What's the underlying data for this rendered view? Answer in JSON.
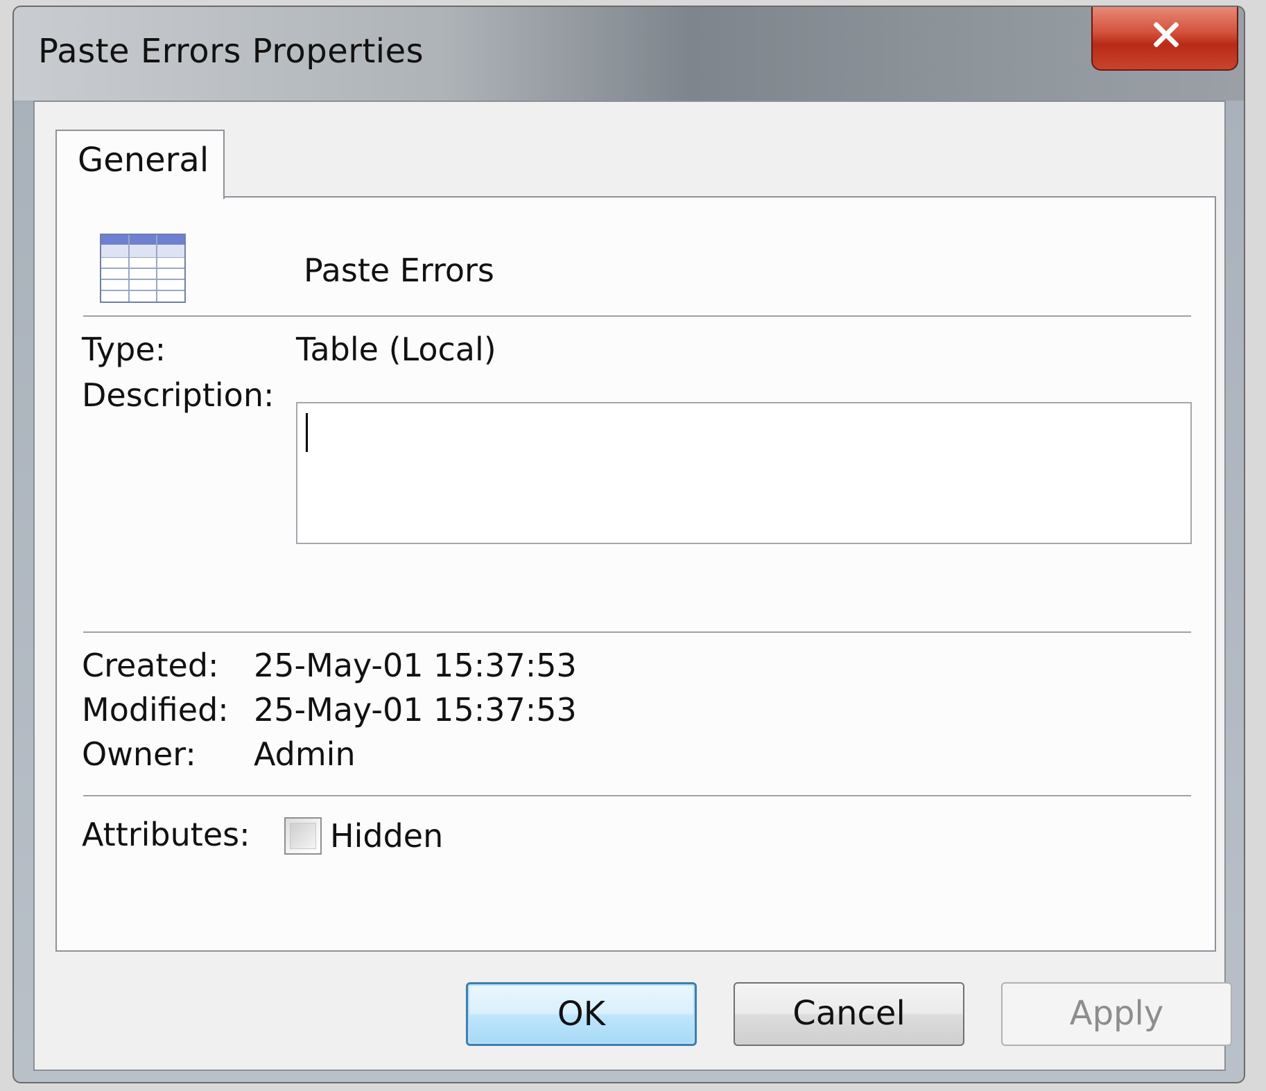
{
  "window": {
    "title": "Paste Errors Properties",
    "close_glyph": "X"
  },
  "tabs": [
    {
      "label": "General",
      "active": true
    }
  ],
  "general": {
    "icon": "table-icon",
    "object_name": "Paste Errors",
    "type_label": "Type:",
    "type_value": "Table (Local)",
    "description_label": "Description:",
    "description_value": "",
    "created_label": "Created:",
    "created_value": "25-May-01 15:37:53",
    "modified_label": "Modified:",
    "modified_value": "25-May-01 15:37:53",
    "owner_label": "Owner:",
    "owner_value": "Admin",
    "attributes_label": "Attributes:",
    "hidden_label": "Hidden",
    "hidden_checked": false
  },
  "buttons": {
    "ok": "OK",
    "cancel": "Cancel",
    "apply": "Apply"
  },
  "colors": {
    "close_button": "#c8432d",
    "ok_border": "#3c7fb1",
    "icon_header": "#6f7fd1"
  }
}
